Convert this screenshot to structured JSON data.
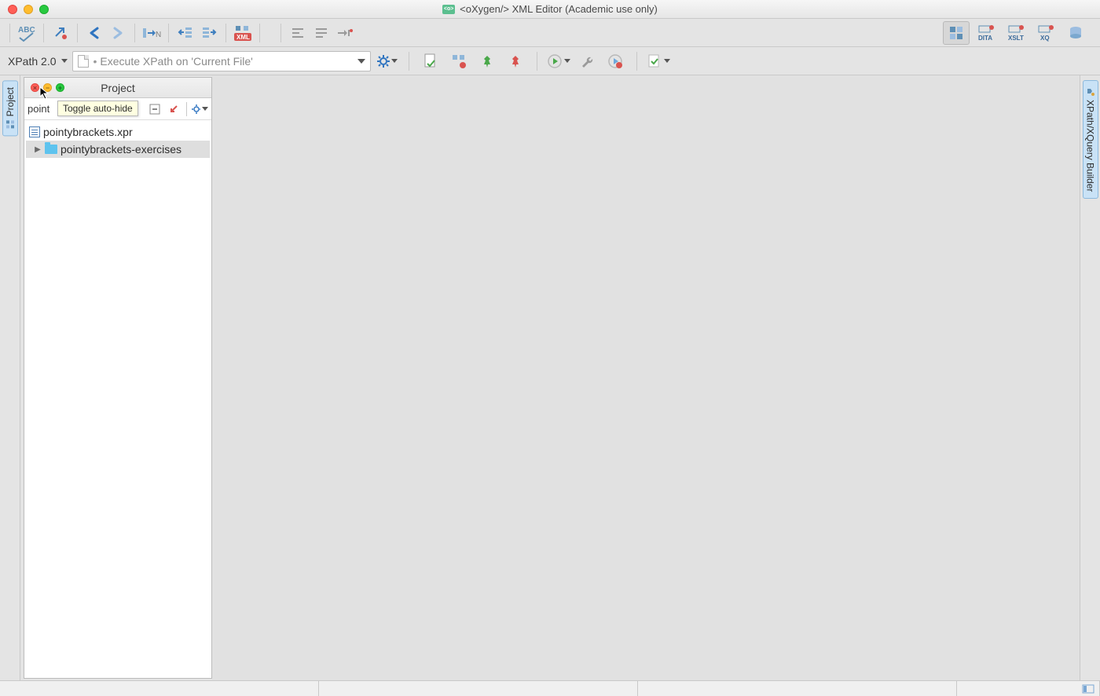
{
  "window": {
    "title": "<oXygen/> XML Editor (Academic use only)"
  },
  "toolbar1": {
    "spellcheck_label": "ABC"
  },
  "perspectives": {
    "grid": "",
    "dita": "DITA",
    "xslt": "XSLT",
    "xq": "XQ"
  },
  "xpath_bar": {
    "version_label": "XPath 2.0",
    "placeholder": "Execute XPath on  'Current File'"
  },
  "left_rail": {
    "project_tab": "Project"
  },
  "right_rail": {
    "builder_tab": "XPath/XQuery Builder"
  },
  "project_panel": {
    "title": "Project",
    "toolbar_text": "point",
    "tooltip": "Toggle auto-hide",
    "tree": {
      "root_file": "pointybrackets.xpr",
      "folder": "pointybrackets-exercises"
    }
  }
}
